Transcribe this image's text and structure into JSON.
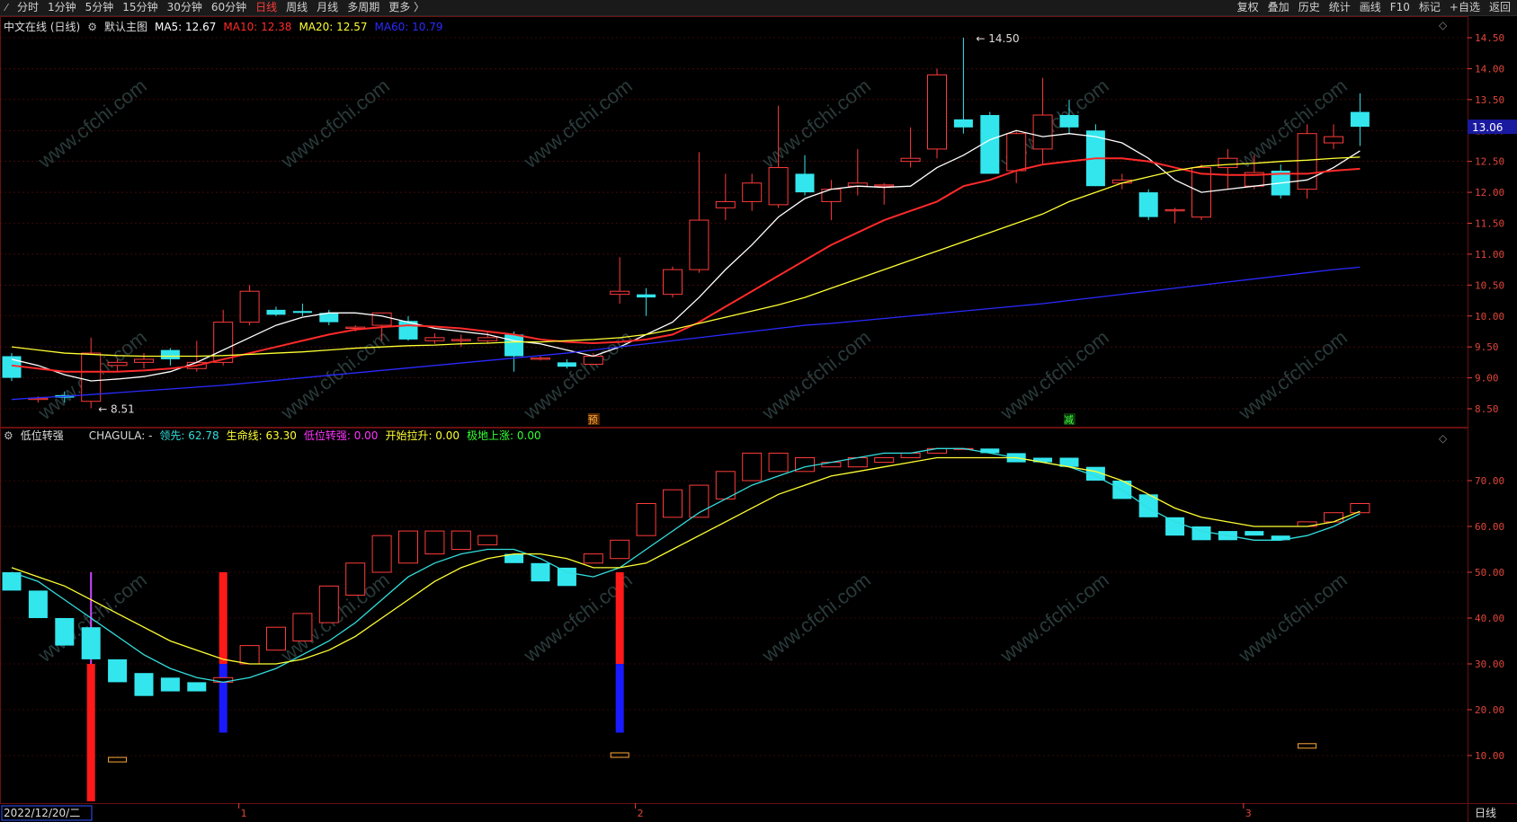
{
  "toolbar": {
    "left": [
      {
        "label": "分时",
        "active": false
      },
      {
        "label": "1分钟",
        "active": false
      },
      {
        "label": "5分钟",
        "active": false
      },
      {
        "label": "15分钟",
        "active": false
      },
      {
        "label": "30分钟",
        "active": false
      },
      {
        "label": "60分钟",
        "active": false
      },
      {
        "label": "日线",
        "active": true
      },
      {
        "label": "周线",
        "active": false
      },
      {
        "label": "月线",
        "active": false
      },
      {
        "label": "多周期",
        "active": false
      },
      {
        "label": "更多 〉",
        "active": false
      }
    ],
    "right": [
      "复权",
      "叠加",
      "历史",
      "统计",
      "画线",
      "F10",
      "标记",
      "+自选",
      "返回"
    ]
  },
  "main_legend": {
    "stock": "中文在线 (日线)",
    "template": "默认主图",
    "items": [
      {
        "text": "MA5: 12.67",
        "color": "#ffffff"
      },
      {
        "text": "MA10: 12.38",
        "color": "#ff2a2a"
      },
      {
        "text": "MA20: 12.57",
        "color": "#ffff33"
      },
      {
        "text": "MA60: 10.79",
        "color": "#2a2aff"
      }
    ]
  },
  "indicator_legend": {
    "name": "低位转强",
    "items": [
      {
        "text": "CHAGULA: -",
        "color": "#dddddd"
      },
      {
        "text": "领先: 62.78",
        "color": "#33dddd"
      },
      {
        "text": "生命线: 63.30",
        "color": "#ffff33"
      },
      {
        "text": "低位转强: 0.00",
        "color": "#ff33ff"
      },
      {
        "text": "开始拉升: 0.00",
        "color": "#ffff33"
      },
      {
        "text": "极地上涨: 0.00",
        "color": "#33ff33"
      }
    ]
  },
  "annotations": {
    "high_label": "14.50",
    "low_label": "8.51",
    "current_price": "13.06",
    "marker_yu": "预",
    "marker_jian": "减",
    "date_label": "2022/12/20/二",
    "month_ticks": [
      "1",
      "2",
      "3"
    ],
    "period_label": "日线",
    "watermark": "www.cfchi.com"
  },
  "colors": {
    "up": "#ff3b3b",
    "down": "#33e6ee",
    "grid": "#6a1010",
    "axis": "#e0453a"
  },
  "chart_data": {
    "type": "candlestick",
    "price_axis": {
      "ylim": [
        8.3,
        14.75
      ],
      "ticks": [
        "14.50",
        "14.00",
        "13.50",
        "13.00",
        "12.50",
        "12.00",
        "11.50",
        "11.00",
        "10.50",
        "10.00",
        "9.50",
        "9.00",
        "8.50"
      ]
    },
    "indicator_axis": {
      "ylim": [
        0,
        80
      ],
      "ticks": [
        "70.00",
        "60.00",
        "50.00",
        "40.00",
        "30.00",
        "20.00",
        "10.00"
      ]
    },
    "candles": [
      {
        "o": 9.35,
        "h": 9.4,
        "l": 8.95,
        "c": 9.0
      },
      {
        "o": 8.65,
        "h": 8.7,
        "l": 8.6,
        "c": 8.67
      },
      {
        "o": 8.72,
        "h": 8.78,
        "l": 8.6,
        "c": 8.68
      },
      {
        "o": 8.62,
        "h": 9.65,
        "l": 8.51,
        "c": 9.4
      },
      {
        "o": 9.2,
        "h": 9.3,
        "l": 9.1,
        "c": 9.25
      },
      {
        "o": 9.25,
        "h": 9.4,
        "l": 9.15,
        "c": 9.3
      },
      {
        "o": 9.45,
        "h": 9.48,
        "l": 9.2,
        "c": 9.3
      },
      {
        "o": 9.15,
        "h": 9.6,
        "l": 9.1,
        "c": 9.25
      },
      {
        "o": 9.25,
        "h": 10.1,
        "l": 9.2,
        "c": 9.9
      },
      {
        "o": 9.9,
        "h": 10.5,
        "l": 9.85,
        "c": 10.4
      },
      {
        "o": 10.1,
        "h": 10.15,
        "l": 10.0,
        "c": 10.02
      },
      {
        "o": 10.08,
        "h": 10.2,
        "l": 10.0,
        "c": 10.05
      },
      {
        "o": 10.05,
        "h": 10.1,
        "l": 9.85,
        "c": 9.9
      },
      {
        "o": 9.8,
        "h": 9.85,
        "l": 9.75,
        "c": 9.82
      },
      {
        "o": 9.85,
        "h": 10.05,
        "l": 9.6,
        "c": 10.05
      },
      {
        "o": 9.92,
        "h": 10.0,
        "l": 9.6,
        "c": 9.62
      },
      {
        "o": 9.6,
        "h": 9.72,
        "l": 9.55,
        "c": 9.65
      },
      {
        "o": 9.6,
        "h": 9.7,
        "l": 9.5,
        "c": 9.62
      },
      {
        "o": 9.6,
        "h": 9.75,
        "l": 9.55,
        "c": 9.65
      },
      {
        "o": 9.7,
        "h": 9.75,
        "l": 9.1,
        "c": 9.35
      },
      {
        "o": 9.3,
        "h": 9.35,
        "l": 9.28,
        "c": 9.32
      },
      {
        "o": 9.25,
        "h": 9.3,
        "l": 9.15,
        "c": 9.18
      },
      {
        "o": 9.22,
        "h": 9.4,
        "l": 9.2,
        "c": 9.35
      },
      {
        "o": 10.35,
        "h": 10.95,
        "l": 10.2,
        "c": 10.4
      },
      {
        "o": 10.35,
        "h": 10.45,
        "l": 10.0,
        "c": 10.3
      },
      {
        "o": 10.35,
        "h": 10.8,
        "l": 10.3,
        "c": 10.75
      },
      {
        "o": 10.75,
        "h": 12.65,
        "l": 10.7,
        "c": 11.55
      },
      {
        "o": 11.75,
        "h": 12.3,
        "l": 11.55,
        "c": 11.85
      },
      {
        "o": 11.85,
        "h": 12.3,
        "l": 11.7,
        "c": 12.15
      },
      {
        "o": 11.8,
        "h": 13.4,
        "l": 11.75,
        "c": 12.4
      },
      {
        "o": 12.3,
        "h": 12.6,
        "l": 11.95,
        "c": 12.0
      },
      {
        "o": 11.85,
        "h": 12.2,
        "l": 11.55,
        "c": 12.05
      },
      {
        "o": 12.1,
        "h": 12.7,
        "l": 11.95,
        "c": 12.15
      },
      {
        "o": 12.1,
        "h": 12.15,
        "l": 11.8,
        "c": 12.12
      },
      {
        "o": 12.5,
        "h": 13.05,
        "l": 12.4,
        "c": 12.55
      },
      {
        "o": 12.7,
        "h": 14.0,
        "l": 12.55,
        "c": 13.9
      },
      {
        "o": 13.18,
        "h": 14.5,
        "l": 12.95,
        "c": 13.05
      },
      {
        "o": 13.25,
        "h": 13.3,
        "l": 12.3,
        "c": 12.3
      },
      {
        "o": 12.35,
        "h": 13.0,
        "l": 12.15,
        "c": 12.95
      },
      {
        "o": 12.7,
        "h": 13.85,
        "l": 12.45,
        "c": 13.25
      },
      {
        "o": 13.25,
        "h": 13.5,
        "l": 12.95,
        "c": 13.05
      },
      {
        "o": 13.0,
        "h": 13.1,
        "l": 12.1,
        "c": 12.1
      },
      {
        "o": 12.15,
        "h": 12.3,
        "l": 12.05,
        "c": 12.2
      },
      {
        "o": 12.0,
        "h": 12.05,
        "l": 11.55,
        "c": 11.6
      },
      {
        "o": 11.7,
        "h": 11.75,
        "l": 11.5,
        "c": 11.72
      },
      {
        "o": 11.6,
        "h": 12.45,
        "l": 11.55,
        "c": 12.4
      },
      {
        "o": 12.4,
        "h": 12.7,
        "l": 12.05,
        "c": 12.55
      },
      {
        "o": 12.1,
        "h": 12.6,
        "l": 12.05,
        "c": 12.32
      },
      {
        "o": 12.35,
        "h": 12.45,
        "l": 11.9,
        "c": 11.95
      },
      {
        "o": 12.05,
        "h": 13.1,
        "l": 11.9,
        "c": 12.95
      },
      {
        "o": 12.8,
        "h": 13.1,
        "l": 12.7,
        "c": 12.9
      },
      {
        "o": 13.3,
        "h": 13.6,
        "l": 12.75,
        "c": 13.06
      }
    ],
    "series": [
      {
        "name": "MA5",
        "color": "#ffffff",
        "values": [
          9.3,
          9.2,
          9.05,
          8.95,
          8.98,
          9.02,
          9.1,
          9.25,
          9.45,
          9.65,
          9.85,
          9.98,
          10.05,
          10.05,
          10.0,
          9.9,
          9.8,
          9.75,
          9.7,
          9.6,
          9.55,
          9.45,
          9.35,
          9.5,
          9.7,
          9.9,
          10.3,
          10.75,
          11.15,
          11.6,
          11.9,
          12.05,
          12.1,
          12.08,
          12.1,
          12.4,
          12.6,
          12.85,
          13.0,
          12.9,
          12.95,
          12.9,
          12.8,
          12.55,
          12.2,
          12.0,
          12.05,
          12.1,
          12.15,
          12.2,
          12.4,
          12.67
        ]
      },
      {
        "name": "MA10",
        "color": "#ff2a2a",
        "values": [
          9.2,
          9.15,
          9.1,
          9.1,
          9.1,
          9.12,
          9.15,
          9.2,
          9.3,
          9.4,
          9.5,
          9.6,
          9.7,
          9.78,
          9.82,
          9.85,
          9.83,
          9.8,
          9.75,
          9.7,
          9.62,
          9.58,
          9.56,
          9.58,
          9.62,
          9.7,
          9.9,
          10.15,
          10.4,
          10.65,
          10.9,
          11.15,
          11.35,
          11.55,
          11.7,
          11.85,
          12.1,
          12.2,
          12.35,
          12.45,
          12.5,
          12.55,
          12.55,
          12.5,
          12.4,
          12.3,
          12.28,
          12.28,
          12.3,
          12.3,
          12.35,
          12.38
        ]
      },
      {
        "name": "MA20",
        "color": "#ffff33",
        "values": [
          9.5,
          9.45,
          9.4,
          9.38,
          9.36,
          9.35,
          9.35,
          9.35,
          9.36,
          9.38,
          9.4,
          9.42,
          9.45,
          9.48,
          9.5,
          9.52,
          9.53,
          9.55,
          9.56,
          9.58,
          9.58,
          9.6,
          9.62,
          9.65,
          9.7,
          9.78,
          9.88,
          9.98,
          10.08,
          10.18,
          10.3,
          10.45,
          10.6,
          10.75,
          10.9,
          11.05,
          11.2,
          11.35,
          11.5,
          11.65,
          11.85,
          12.0,
          12.15,
          12.25,
          12.35,
          12.42,
          12.45,
          12.47,
          12.5,
          12.52,
          12.55,
          12.57
        ]
      },
      {
        "name": "MA60",
        "color": "#2a2aff",
        "values": [
          8.65,
          8.68,
          8.7,
          8.73,
          8.76,
          8.79,
          8.82,
          8.85,
          8.88,
          8.92,
          8.96,
          9.0,
          9.04,
          9.08,
          9.12,
          9.16,
          9.2,
          9.24,
          9.28,
          9.32,
          9.36,
          9.4,
          9.45,
          9.5,
          9.55,
          9.6,
          9.65,
          9.7,
          9.75,
          9.8,
          9.85,
          9.88,
          9.92,
          9.96,
          10.0,
          10.04,
          10.08,
          10.12,
          10.16,
          10.2,
          10.25,
          10.3,
          10.35,
          10.4,
          10.45,
          10.5,
          10.55,
          10.6,
          10.65,
          10.7,
          10.75,
          10.79
        ]
      }
    ],
    "indicator": {
      "bars": [
        {
          "o": 50,
          "c": 46
        },
        {
          "o": 46,
          "c": 40
        },
        {
          "o": 40,
          "c": 34
        },
        {
          "o": 38,
          "c": 31
        },
        {
          "o": 31,
          "c": 26
        },
        {
          "o": 28,
          "c": 23
        },
        {
          "o": 27,
          "c": 24
        },
        {
          "o": 26,
          "c": 24
        },
        {
          "o": 26,
          "c": 27
        },
        {
          "o": 30,
          "c": 34
        },
        {
          "o": 33,
          "c": 38
        },
        {
          "o": 35,
          "c": 41
        },
        {
          "o": 39,
          "c": 47
        },
        {
          "o": 45,
          "c": 52
        },
        {
          "o": 50,
          "c": 58
        },
        {
          "o": 52,
          "c": 59
        },
        {
          "o": 54,
          "c": 59
        },
        {
          "o": 55,
          "c": 59
        },
        {
          "o": 56,
          "c": 58
        },
        {
          "o": 54,
          "c": 52
        },
        {
          "o": 52,
          "c": 48
        },
        {
          "o": 51,
          "c": 47
        },
        {
          "o": 52,
          "c": 54
        },
        {
          "o": 53,
          "c": 57
        },
        {
          "o": 58,
          "c": 65
        },
        {
          "o": 62,
          "c": 68
        },
        {
          "o": 62,
          "c": 69
        },
        {
          "o": 66,
          "c": 72
        },
        {
          "o": 70,
          "c": 76
        },
        {
          "o": 72,
          "c": 76
        },
        {
          "o": 72,
          "c": 75
        },
        {
          "o": 73,
          "c": 74
        },
        {
          "o": 73,
          "c": 75
        },
        {
          "o": 74,
          "c": 75
        },
        {
          "o": 75,
          "c": 76
        },
        {
          "o": 76,
          "c": 77
        },
        {
          "o": 77,
          "c": 77
        },
        {
          "o": 77,
          "c": 76
        },
        {
          "o": 76,
          "c": 74
        },
        {
          "o": 75,
          "c": 74
        },
        {
          "o": 75,
          "c": 73
        },
        {
          "o": 73,
          "c": 70
        },
        {
          "o": 70,
          "c": 66
        },
        {
          "o": 67,
          "c": 62
        },
        {
          "o": 62,
          "c": 58
        },
        {
          "o": 60,
          "c": 57
        },
        {
          "o": 59,
          "c": 57
        },
        {
          "o": 59,
          "c": 58
        },
        {
          "o": 58,
          "c": 57
        },
        {
          "o": 60,
          "c": 61
        },
        {
          "o": 61,
          "c": 63
        },
        {
          "o": 63,
          "c": 65
        }
      ],
      "lead": [
        50,
        48,
        44,
        40,
        36,
        32,
        29,
        27,
        26,
        27,
        29,
        32,
        35,
        39,
        44,
        49,
        52,
        54,
        55,
        55,
        53,
        50,
        49,
        51,
        55,
        59,
        63,
        66,
        69,
        71,
        73,
        74,
        75,
        76,
        76,
        77,
        77,
        76,
        75,
        74,
        73,
        71,
        68,
        64,
        61,
        59,
        58,
        57,
        57,
        58,
        60,
        62.78
      ],
      "life": [
        51,
        49,
        47,
        44,
        41,
        38,
        35,
        33,
        31,
        30,
        30,
        31,
        33,
        36,
        40,
        44,
        48,
        51,
        53,
        54,
        54,
        53,
        51,
        51,
        52,
        55,
        58,
        61,
        64,
        67,
        69,
        71,
        72,
        73,
        74,
        75,
        75,
        75,
        75,
        74,
        73,
        72,
        70,
        67,
        64,
        62,
        61,
        60,
        60,
        60,
        61,
        63.3
      ],
      "signals": [
        {
          "i": 3,
          "top": 50,
          "bottom": 30,
          "color": "#cc44ff"
        },
        {
          "i": 3,
          "top": 30,
          "bottom": 0,
          "color": "#ff1a1a"
        },
        {
          "i": 8,
          "top": 50,
          "bottom": 30,
          "color": "#ff1a1a"
        },
        {
          "i": 8,
          "top": 30,
          "bottom": 15,
          "color": "#1a1aff"
        },
        {
          "i": 23,
          "top": 50,
          "bottom": 30,
          "color": "#ff1a1a"
        },
        {
          "i": 23,
          "top": 30,
          "bottom": 15,
          "color": "#1a1aff"
        }
      ],
      "small_marks": [
        {
          "i": 4,
          "v": 9
        },
        {
          "i": 23,
          "v": 10
        },
        {
          "i": 49,
          "v": 12
        }
      ]
    }
  }
}
